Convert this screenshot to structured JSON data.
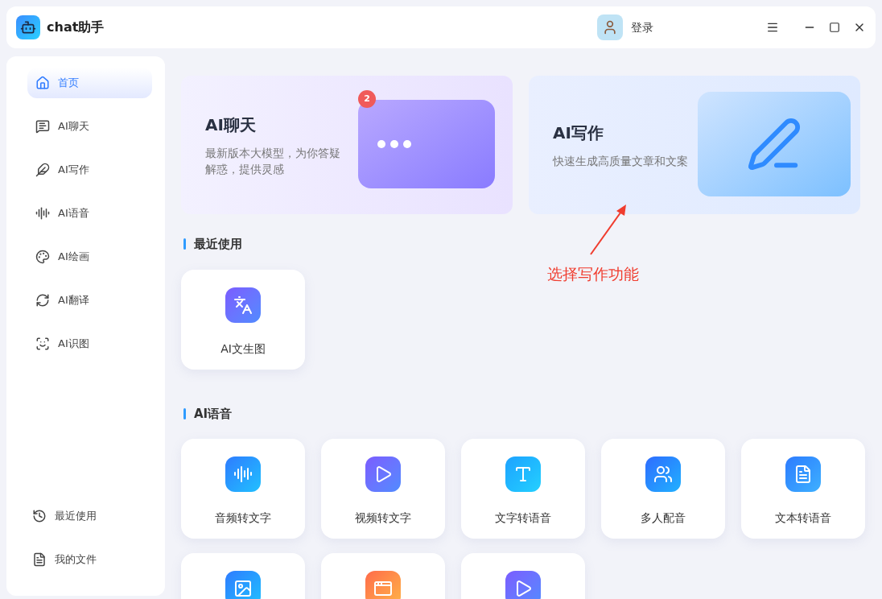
{
  "app": {
    "title": "chat助手",
    "login": "登录"
  },
  "sidebar": {
    "items": [
      {
        "label": "首页",
        "kind": "home",
        "selected": true
      },
      {
        "label": "AI聊天",
        "kind": "chat",
        "selected": false
      },
      {
        "label": "AI写作",
        "kind": "feather",
        "selected": false
      },
      {
        "label": "AI语音",
        "kind": "voice",
        "selected": false
      },
      {
        "label": "AI绘画",
        "kind": "palette",
        "selected": false
      },
      {
        "label": "AI翻译",
        "kind": "translate",
        "selected": false
      },
      {
        "label": "AI识图",
        "kind": "scan",
        "selected": false
      }
    ],
    "bottom_items": [
      {
        "label": "最近使用",
        "kind": "history"
      },
      {
        "label": "我的文件",
        "kind": "file"
      }
    ]
  },
  "banners": [
    {
      "title": "AI聊天",
      "description": "最新版本大模型，为你答疑解惑，提供灵感",
      "kind": "chat",
      "badge": "2"
    },
    {
      "title": "AI写作",
      "description": "快速生成高质量文章和文案",
      "kind": "writing"
    }
  ],
  "annotation": {
    "text": "选择写作功能"
  },
  "sections": [
    {
      "title": "最近使用",
      "tiles": [
        {
          "label": "AI文生图",
          "kind": "text-image"
        }
      ]
    },
    {
      "title": "AI语音",
      "tiles": [
        {
          "label": "音频转文字",
          "kind": "audio-text"
        },
        {
          "label": "视频转文字",
          "kind": "video-text"
        },
        {
          "label": "文字转语音",
          "kind": "text-speech"
        },
        {
          "label": "多人配音",
          "kind": "dubbing"
        },
        {
          "label": "文本转语音",
          "kind": "doc-speech"
        },
        {
          "kind": "image"
        },
        {
          "kind": "web"
        },
        {
          "kind": "video"
        }
      ]
    }
  ]
}
